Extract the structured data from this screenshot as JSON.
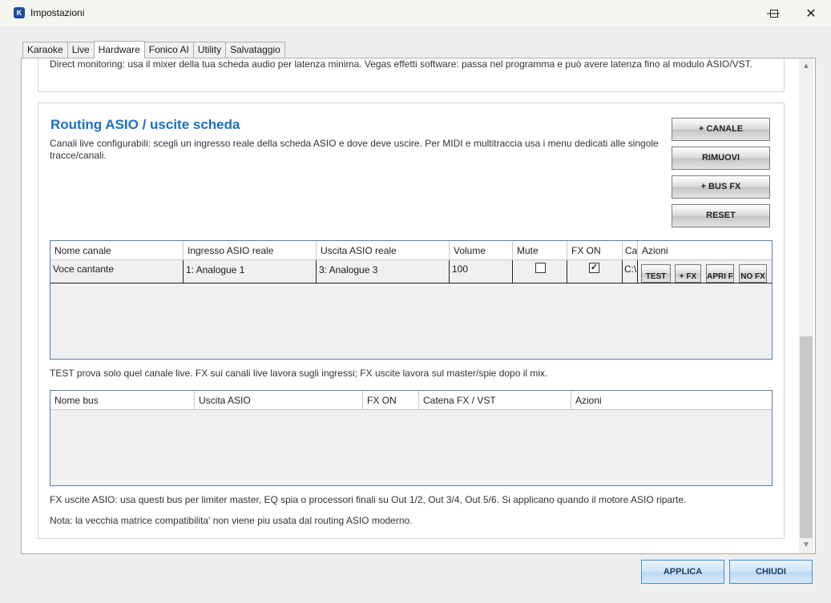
{
  "window": {
    "title": "Impostazioni",
    "icon_letter": "K",
    "controls": {
      "minimize": "—",
      "maximize": "☐",
      "close": "✕"
    }
  },
  "tabs": [
    {
      "label": "Karaoke",
      "active": false
    },
    {
      "label": "Live",
      "active": false
    },
    {
      "label": "Hardware",
      "active": true
    },
    {
      "label": "Fonico AI",
      "active": false
    },
    {
      "label": "Utility",
      "active": false
    },
    {
      "label": "Salvataggio",
      "active": false
    }
  ],
  "top_note": "Direct monitoring: usa il mixer della tua scheda audio per latenza minima. Vegas effetti software: passa nel programma e può avere latenza fino al modulo ASIO/VST.",
  "routing": {
    "title": "Routing ASIO / uscite scheda",
    "description": "Canali live configurabili: scegli un ingresso reale della scheda ASIO e dove deve uscire. Per MIDI e multitraccia usa i menu dedicati alle singole tracce/canali.",
    "buttons": {
      "add_channel": "+ CANALE",
      "remove": "RIMUOVI",
      "add_bus_fx": "+ BUS FX",
      "reset": "RESET"
    },
    "channels_table": {
      "columns": [
        "Nome canale",
        "Ingresso ASIO reale",
        "Uscita ASIO reale",
        "Volume",
        "Mute",
        "FX ON",
        "Ca",
        "Azioni"
      ],
      "rows": [
        {
          "name": "Voce cantante",
          "input": "1: Analogue 1",
          "output": "3: Analogue 3",
          "volume": "100",
          "mute": false,
          "fx_on": true,
          "chain": "C:\\",
          "actions": [
            "TEST",
            "+ FX",
            "APRI F",
            "NO FX"
          ]
        }
      ]
    },
    "test_note": "TEST prova solo quel canale live. FX sui canali live lavora sugli ingressi; FX uscite lavora sul master/spie dopo il mix.",
    "bus_table": {
      "columns": [
        "Nome bus",
        "Uscita ASIO",
        "FX ON",
        "Catena FX / VST",
        "Azioni"
      ],
      "rows": []
    },
    "fx_note": "FX uscite ASIO: usa questi bus per limiter master, EQ spia o processori finali su Out 1/2, Out 3/4, Out 5/6. Si applicano quando il motore ASIO riparte.",
    "matrix_note": "Nota: la vecchia matrice compatibilita' non viene piu usata dal routing ASIO moderno."
  },
  "footer": {
    "apply": "APPLICA",
    "close": "CHIUDI"
  },
  "scrollbar": {
    "up": "▲",
    "down": "▼"
  },
  "checkmark": "✓"
}
